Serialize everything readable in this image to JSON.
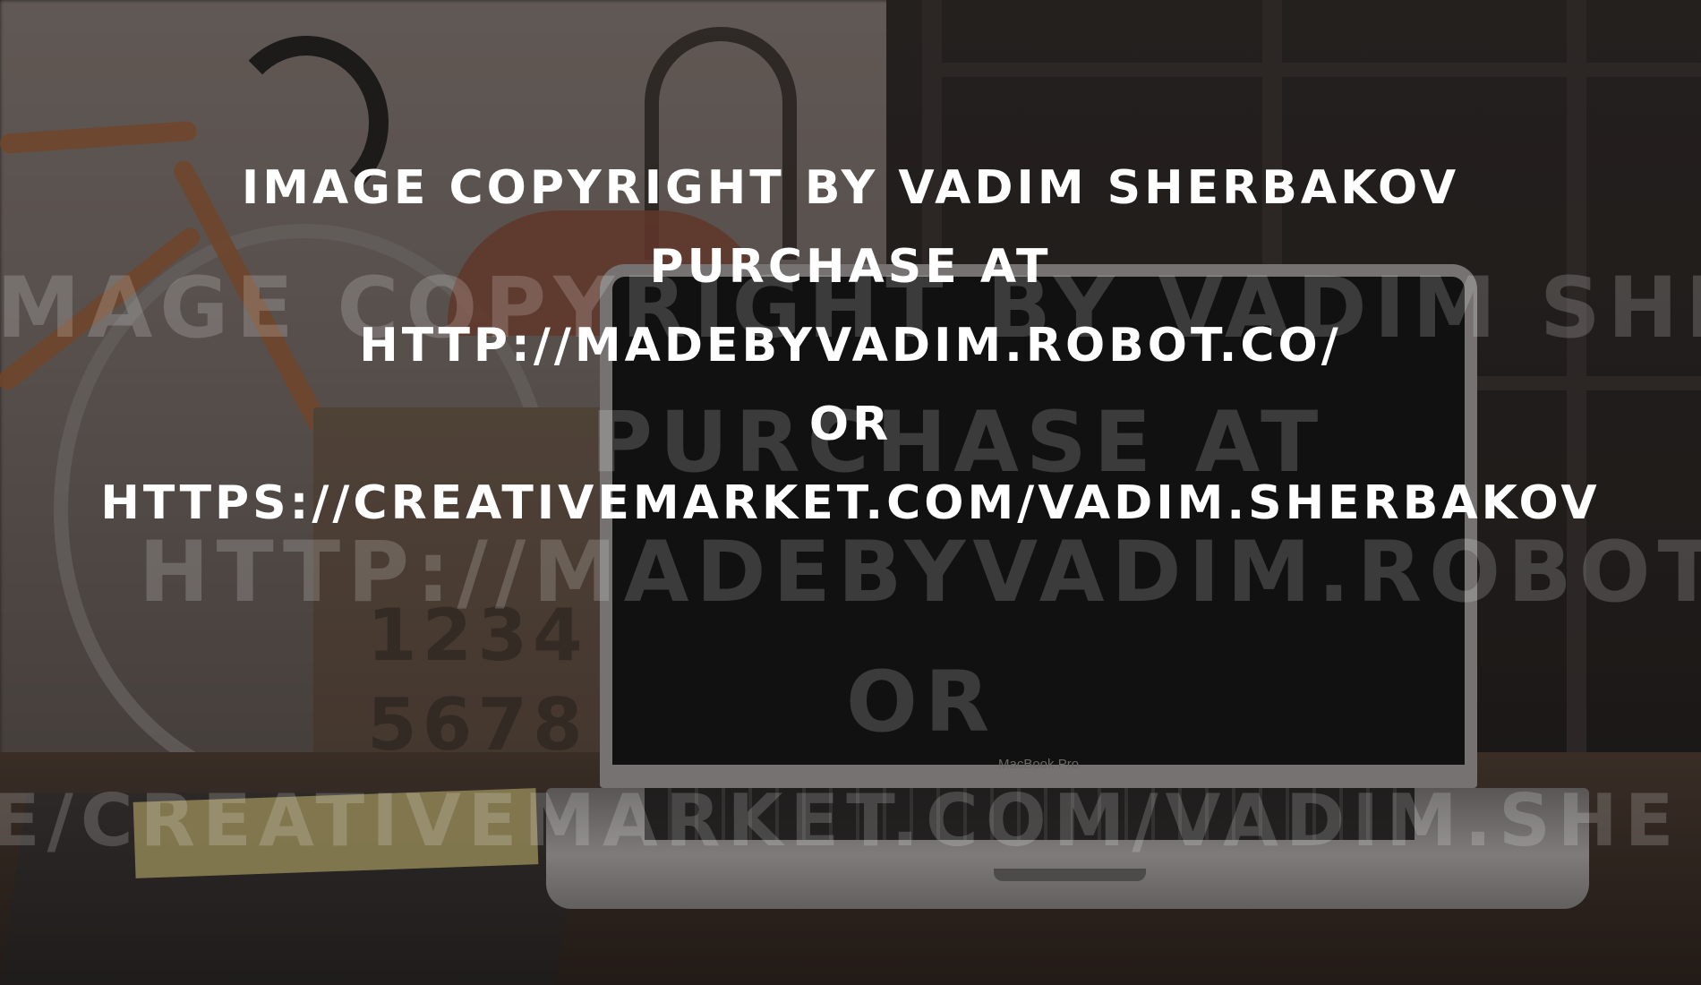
{
  "photo": {
    "laptop_brand": "MacBook Pro",
    "crate_digits": "1234 5678"
  },
  "watermark_background": {
    "line1": "MAGE COPYRIGHT BY VADIM SHERBAK",
    "line2": "PURCHASE AT",
    "line3": "HTTP://MADEBYVADIM.ROBOT.CO/",
    "line4": "OR",
    "line5": "E/CREATIVEMARKET.COM/VADIM.SHE"
  },
  "watermark_foreground": {
    "line1": "IMAGE COPYRIGHT BY VADIM SHERBAKOV",
    "line2": "PURCHASE AT",
    "line3": "HTTP://MADEBYVADIM.ROBOT.CO/",
    "line4": "OR",
    "line5": "HTTPS://CREATIVEMARKET.COM/VADIM.SHERBAKOV"
  },
  "colors": {
    "overlay_text": "#ffffff",
    "faint_text": "rgba(255,255,255,0.18)"
  }
}
